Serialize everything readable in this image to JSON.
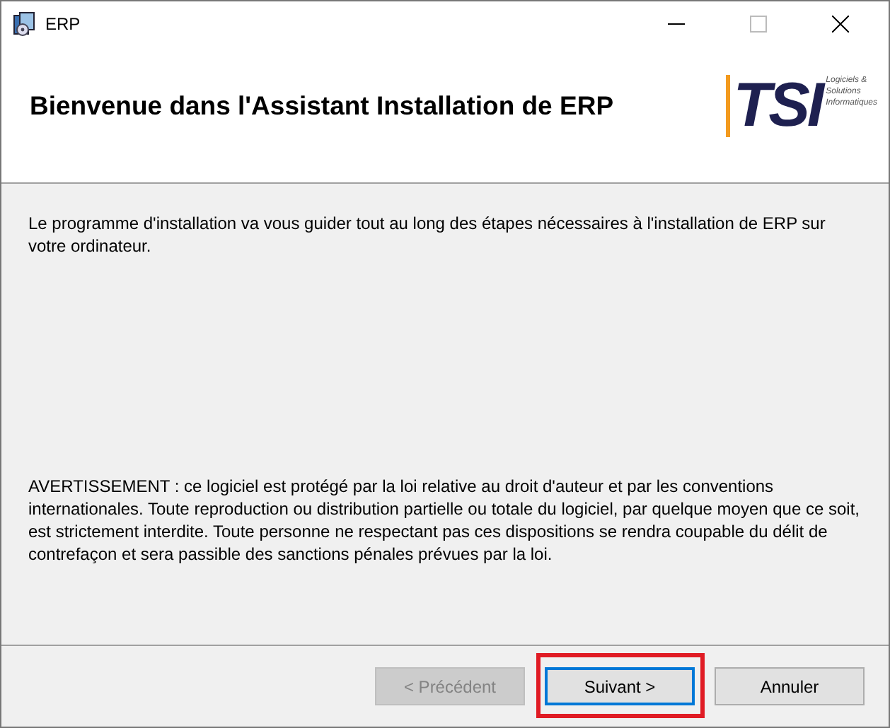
{
  "window": {
    "title": "ERP"
  },
  "header": {
    "title": "Bienvenue dans l'Assistant Installation de ERP",
    "logo": {
      "letters": "TSI",
      "tagline": [
        "Logiciels &",
        "Solutions",
        "Informatiques"
      ]
    }
  },
  "intro": "Le programme d'installation va vous guider tout au long des étapes nécessaires à l'installation de ERP sur votre ordinateur.",
  "warning": "AVERTISSEMENT : ce logiciel est protégé par la loi relative au droit d'auteur et par les conventions internationales. Toute reproduction ou distribution partielle ou totale du logiciel, par quelque moyen que ce soit, est strictement interdite. Toute personne ne respectant pas ces dispositions se rendra coupable du délit de contrefaçon et sera passible des sanctions pénales prévues par la loi.",
  "buttons": [
    {
      "label": "< Précédent",
      "disabled": true,
      "focused": false,
      "highlighted": false
    },
    {
      "label": "Suivant >",
      "disabled": false,
      "focused": true,
      "highlighted": true
    },
    {
      "label": "Annuler",
      "disabled": false,
      "focused": false,
      "highlighted": false
    }
  ]
}
